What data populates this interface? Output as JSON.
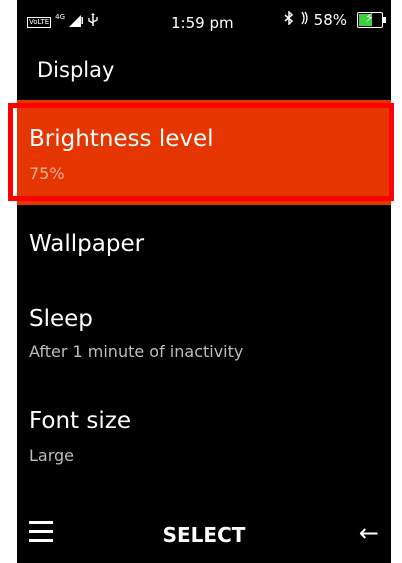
{
  "status_bar": {
    "volte": "VoLTE",
    "network": "4G",
    "time": "1:59 pm",
    "battery_percent": "58%",
    "battery_level": 0.58,
    "signal_icon": "signal-icon",
    "usb_icon": "usb-icon",
    "bluetooth_icon": "bluetooth-icon",
    "wifi_calling_icon": "wifi-calling-icon"
  },
  "header": {
    "title": "Display"
  },
  "settings": {
    "items": [
      {
        "title": "Brightness level",
        "subtitle": "75%"
      },
      {
        "title": "Wallpaper"
      },
      {
        "title": "Sleep",
        "subtitle": "After 1 minute of inactivity"
      },
      {
        "title": "Font size",
        "subtitle": "Large"
      }
    ]
  },
  "softkeys": {
    "left_icon": "menu-icon",
    "center_label": "SELECT",
    "right_icon": "back-arrow-icon"
  },
  "colors": {
    "selected_background": "#e53500",
    "highlight_outline": "#ff0000",
    "battery_fill": "#3ed13e"
  }
}
